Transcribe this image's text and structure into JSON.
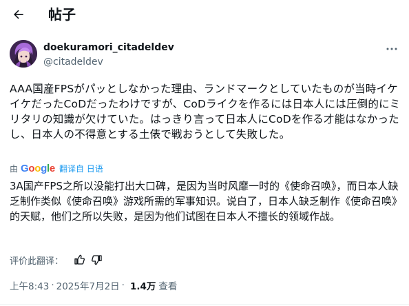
{
  "header": {
    "title": "帖子"
  },
  "post": {
    "display_name": "doekuramori_citadeldev",
    "handle": "@citadeldev",
    "text": "AAA国産FPSがパッとしなかった理由、ランドマークとしていたものが当時イケイケだったCoDだったわけですが、CoDライクを作るには日本人には圧倒的にミリタリの知識が欠けていた。はっきり言って日本人にCoDを作る才能はなかったし、日本人の不得意とする土俵で戦おうとして失敗した。",
    "translation": {
      "by": "由",
      "provider": "Google",
      "link": "翻译自 日语",
      "text": "3A国产FPS之所以没能打出大口碑，是因为当时风靡一时的《使命召唤》，而日本人缺乏制作类似《使命召唤》游戏所需的军事知识。说白了，日本人缺乏制作《使命召唤》的天赋，他们之所以失败，是因为他们试图在日本人不擅长的领域作战。",
      "rate_label": "评价此翻译："
    },
    "time": "上午8:43",
    "separator": "·",
    "date": "2025年7月2日",
    "views": "1.4万",
    "views_label": "查看"
  },
  "colors": {
    "text": "#0f1419",
    "secondary": "#536471",
    "link": "#1d9bf0",
    "google_blue": "#4285f4",
    "google_red": "#ea4335",
    "google_yellow": "#fbbc05",
    "google_green": "#34a853"
  },
  "icons": {
    "back": "arrow-left-icon",
    "more": "more-horizontal-icon",
    "thumbs_up": "thumbs-up-icon",
    "thumbs_down": "thumbs-down-icon"
  }
}
